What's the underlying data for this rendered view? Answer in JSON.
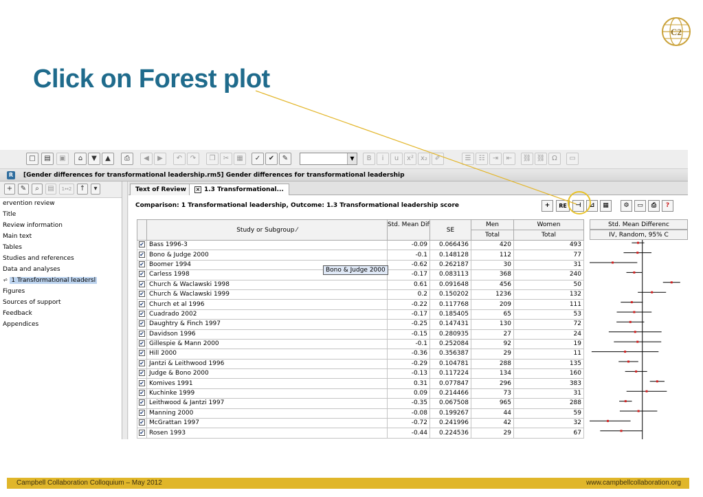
{
  "slide": {
    "title": "Click on Forest plot",
    "footer_left": "Campbell Collaboration Colloquium – May 2012",
    "footer_right": "www.campbellcollaboration.org",
    "logo": "C2",
    "accent": "#1f6b8c",
    "footer_color": "#e0b62a"
  },
  "app": {
    "document_title": "[Gender differences for transformational leadership.rm5] Gender differences for transformational leadership",
    "outline": [
      "ervention review",
      "Title",
      "Review information",
      "Main text",
      "Tables",
      "Studies and references",
      "Data and analyses",
      "1 Transformational leadersl",
      "Figures",
      "Sources of support",
      "Feedback",
      "Appendices"
    ],
    "outline_selected": "1 Transformational leadersl",
    "tabs": [
      "Text of Review",
      "1.3 Transformational..."
    ],
    "comparison": "Comparison: 1 Transformational leadership, Outcome: 1.3 Transformational leadership score",
    "columns": {
      "study": "Study or Subgroup",
      "smd": "Std. Mean Difference",
      "se": "SE",
      "men": "Men",
      "men_sub": "Total",
      "women": "Women",
      "women_sub": "Total",
      "forest": "Std. Mean Differenc",
      "forest_sub": "IV, Random, 95% C"
    },
    "tooltip": "Bono & Judge 2000",
    "rows": [
      {
        "study": "Bass 1996-3",
        "smd": "-0.09",
        "se": "0.066436",
        "men": "420",
        "women": "493"
      },
      {
        "study": "Bono & Judge 2000",
        "smd": "-0.1",
        "se": "0.148128",
        "men": "112",
        "women": "77"
      },
      {
        "study": "Boomer 1994",
        "smd": "-0.62",
        "se": "0.262187",
        "men": "30",
        "women": "31"
      },
      {
        "study": "Carless 1998",
        "smd": "-0.17",
        "se": "0.083113",
        "men": "368",
        "women": "240"
      },
      {
        "study": "Church & Waclawski 1998",
        "smd": "0.61",
        "se": "0.091648",
        "men": "456",
        "women": "50"
      },
      {
        "study": "Church & Waclawski 1999",
        "smd": "0.2",
        "se": "0.150202",
        "men": "1236",
        "women": "132"
      },
      {
        "study": "Church et al 1996",
        "smd": "-0.22",
        "se": "0.117768",
        "men": "209",
        "women": "111"
      },
      {
        "study": "Cuadrado 2002",
        "smd": "-0.17",
        "se": "0.185405",
        "men": "65",
        "women": "53"
      },
      {
        "study": "Daughtry & Finch 1997",
        "smd": "-0.25",
        "se": "0.147431",
        "men": "130",
        "women": "72"
      },
      {
        "study": "Davidson 1996",
        "smd": "-0.15",
        "se": "0.280935",
        "men": "27",
        "women": "24"
      },
      {
        "study": "Gillespie & Mann 2000",
        "smd": "-0.1",
        "se": "0.252084",
        "men": "92",
        "women": "19"
      },
      {
        "study": "Hill 2000",
        "smd": "-0.36",
        "se": "0.356387",
        "men": "29",
        "women": "11"
      },
      {
        "study": "Jantzi & Leithwood 1996",
        "smd": "-0.29",
        "se": "0.104781",
        "men": "288",
        "women": "135"
      },
      {
        "study": "Judge & Bono 2000",
        "smd": "-0.13",
        "se": "0.117224",
        "men": "134",
        "women": "160"
      },
      {
        "study": "Komives 1991",
        "smd": "0.31",
        "se": "0.077847",
        "men": "296",
        "women": "383"
      },
      {
        "study": "Kuchinke 1999",
        "smd": "0.09",
        "se": "0.214466",
        "men": "73",
        "women": "31"
      },
      {
        "study": "Leithwood & Jantzi 1997",
        "smd": "-0.35",
        "se": "0.067508",
        "men": "965",
        "women": "288"
      },
      {
        "study": "Manning 2000",
        "smd": "-0.08",
        "se": "0.199267",
        "men": "44",
        "women": "59"
      },
      {
        "study": "McGrattan 1997",
        "smd": "-0.72",
        "se": "0.241996",
        "men": "42",
        "women": "32"
      },
      {
        "study": "Rosen 1993",
        "smd": "-0.44",
        "se": "0.224536",
        "men": "29",
        "women": "67"
      }
    ]
  }
}
